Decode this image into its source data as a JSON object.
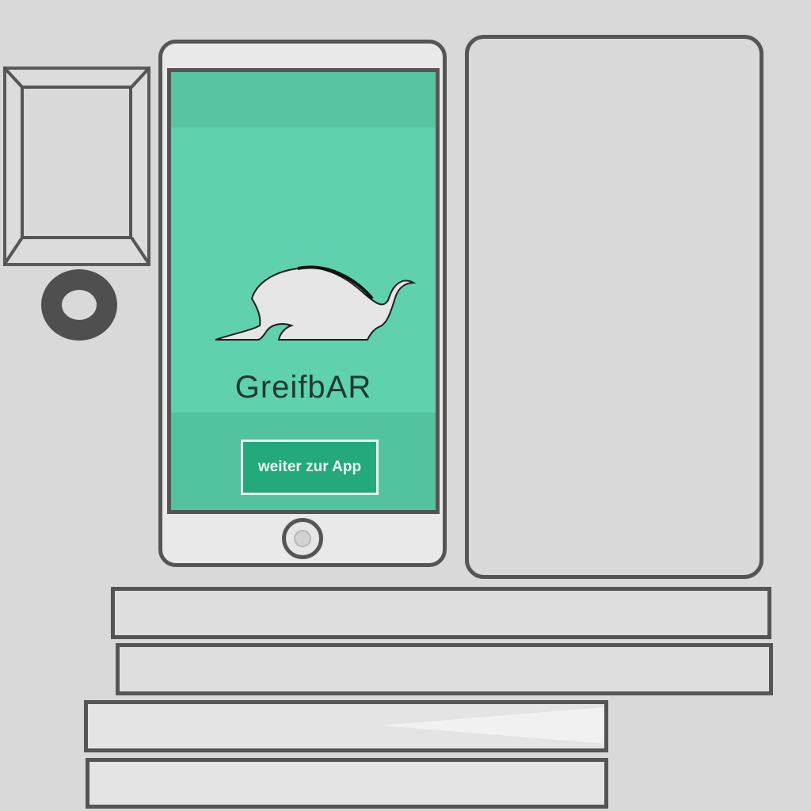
{
  "app": {
    "name": "GreifbAR",
    "cta_label": "weiter zur App"
  },
  "icons": {
    "logo": "crouching-animal-logo",
    "home": "home-button-icon"
  },
  "colors": {
    "screen": "#5fd1ae",
    "button": "#23a97c",
    "outline": "#555555",
    "background": "#d9d9d9"
  }
}
